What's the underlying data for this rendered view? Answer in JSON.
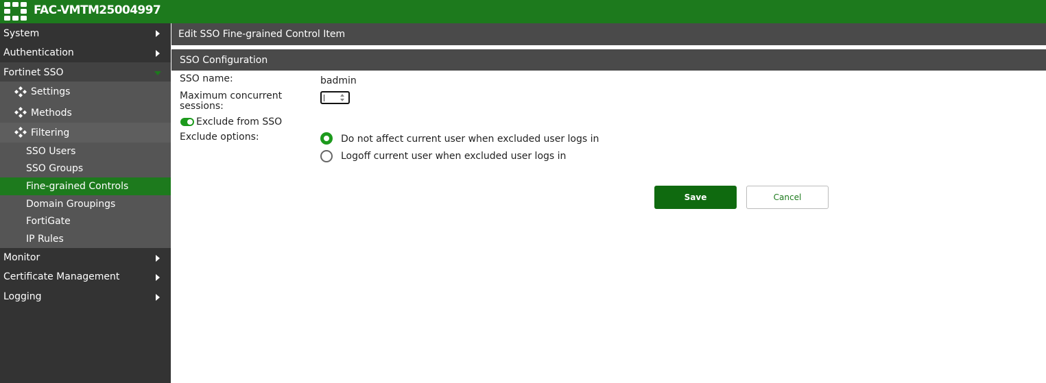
{
  "app": {
    "title": "FAC-VMTM25004997"
  },
  "sidebar": {
    "system": "System",
    "authentication": "Authentication",
    "fortinet_sso": "Fortinet SSO",
    "settings": "Settings",
    "methods": "Methods",
    "filtering": "Filtering",
    "sso_users": "SSO Users",
    "sso_groups": "SSO Groups",
    "fine_grained_controls": "Fine-grained Controls",
    "domain_groupings": "Domain Groupings",
    "fortigate": "FortiGate",
    "ip_rules": "IP Rules",
    "monitor": "Monitor",
    "certificate_management": "Certificate Management",
    "logging": "Logging"
  },
  "page": {
    "title": "Edit SSO Fine-grained Control Item",
    "section": "SSO Configuration"
  },
  "form": {
    "sso_name_label": "SSO name:",
    "sso_name_value": "badmin",
    "max_sessions_label_1": "Maximum concurrent",
    "max_sessions_label_2": "sessions:",
    "max_sessions_value": "",
    "exclude_label": "Exclude from SSO",
    "exclude_enabled": true,
    "exclude_options_label": "Exclude options:",
    "options": [
      {
        "label": "Do not affect current user when excluded user logs in",
        "selected": true
      },
      {
        "label": "Logoff current user when excluded user logs in",
        "selected": false
      }
    ]
  },
  "buttons": {
    "save": "Save",
    "cancel": "Cancel"
  },
  "colors": {
    "brand": "#1d7a1d",
    "sidebar": "#333333",
    "header": "#4a4a4a"
  }
}
